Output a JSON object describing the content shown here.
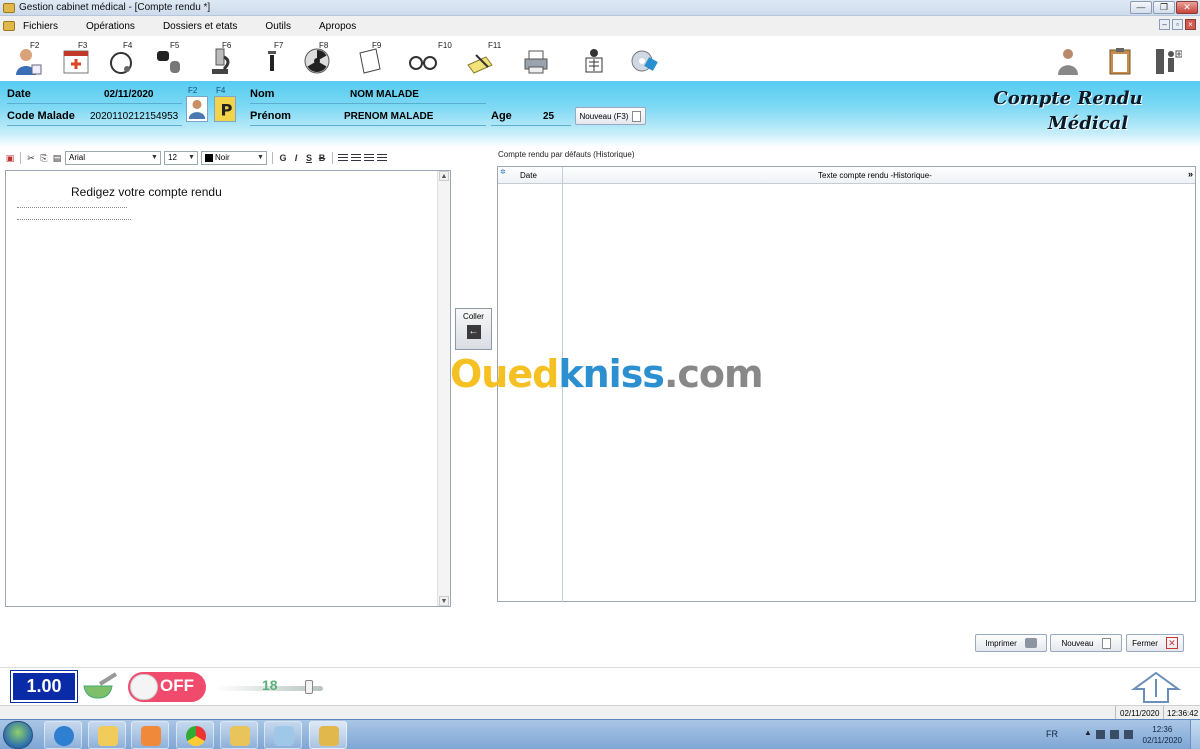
{
  "window": {
    "title": "Gestion cabinet médical - [Compte rendu *]"
  },
  "menu": {
    "items": [
      "Fichiers",
      "Opérations",
      "Dossiers et etats",
      "Outils",
      "Apropos"
    ]
  },
  "toolbar": {
    "tools": [
      {
        "key": "F2",
        "icon": "patient-icon"
      },
      {
        "key": "F3",
        "icon": "medical-calendar-icon"
      },
      {
        "key": "F4",
        "icon": "stethoscope-icon"
      },
      {
        "key": "F5",
        "icon": "test-tube-icon"
      },
      {
        "key": "F6",
        "icon": "microscope-icon"
      },
      {
        "key": "F7",
        "icon": "syringe-icon"
      },
      {
        "key": "F8",
        "icon": "radiation-icon"
      },
      {
        "key": "F9",
        "icon": "document-icon"
      },
      {
        "key": "F10",
        "icon": "glasses-icon"
      },
      {
        "key": "F11",
        "icon": "notes-icon"
      },
      {
        "key": "",
        "icon": "printer-icon"
      },
      {
        "key": "",
        "icon": "xray-icon"
      },
      {
        "key": "",
        "icon": "disc-icon"
      }
    ],
    "right_icons": [
      "doctor-icon",
      "clipboard-icon",
      "exit-door-icon"
    ]
  },
  "header": {
    "date_label": "Date",
    "date_value": "02/11/2020",
    "code_label": "Code Malade",
    "code_value": "2020110212154953",
    "fkey_1": "F2",
    "fkey_2": "F4",
    "nom_label": "Nom",
    "nom_value": "NOM MALADE",
    "prenom_label": "Prénom",
    "prenom_value": "PRENOM MALADE",
    "age_label": "Age",
    "age_value": "25",
    "nouveau_label": "Nouveau (F3)",
    "brand_line1": "Compte Rendu",
    "brand_line2": "Médical"
  },
  "editor": {
    "font": "Arial",
    "size": "12",
    "color": "Noir",
    "bold": "G",
    "italic": "I",
    "underline": "S",
    "strike": "B",
    "prompt": "Redigez votre compte rendu"
  },
  "coller": {
    "label": "Coller",
    "arrow": "←"
  },
  "history": {
    "label": "Compte rendu par défauts (Historique)",
    "col_date": "Date",
    "col_text": "Texte compte rendu -Historique-",
    "more": "»"
  },
  "watermark": {
    "part1": "Oued",
    "part2": "kniss",
    "part3": ".com"
  },
  "actions": {
    "print": "Imprimer",
    "new": "Nouveau",
    "close": "Fermer"
  },
  "status": {
    "zoom": "1.00",
    "toggle": "OFF",
    "slider_value": "18",
    "date": "02/11/2020",
    "time": "12:36:42"
  },
  "taskbar": {
    "lang": "FR",
    "clock_time": "12:36",
    "clock_date": "02/11/2020"
  },
  "colors": {
    "header_gradient_top": "#55ccf0",
    "zoom_box": "#0a2ba8",
    "toggle_off": "#f04a6c",
    "slider_value": "#5ab07a"
  }
}
